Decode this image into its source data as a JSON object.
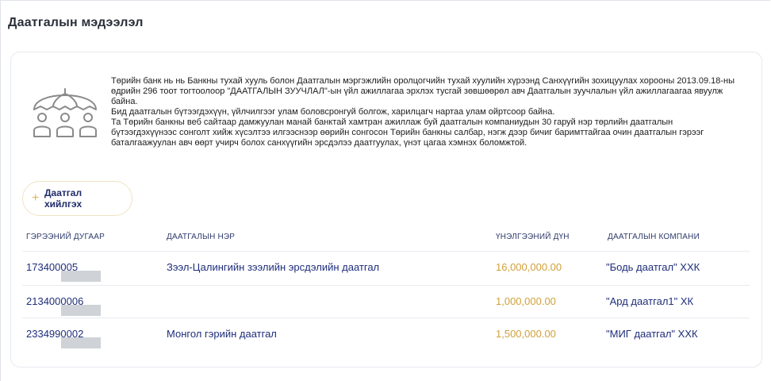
{
  "page": {
    "title": "Даатгалын мэдээлэл"
  },
  "info": {
    "paragraphs": [
      "Төрийн банк нь нь Банкны тухай хууль болон Даатгалын мэргэжлийн оролцогчийн тухай хуулийн хүрээнд Санхүүгийн зохицуулах хорооны 2013.09.18-ны өдрийн 296 тоот тогтоолоор \"ДААТГАЛЫН ЗУУЧЛАЛ\"-ын үйл ажиллагаа эрхлэх тусгай зөвшөөрөл авч Даатгалын зуучлалын үйл ажиллагаагаа явуулж байна.",
      "Бид даатгалын бүтээгдэхүүн, үйлчилгээг улам боловсронгуй болгож, харилцагч нартаа улам ойртсоор байна.",
      "Та Төрийн банкны веб сайтаар дамжуулан манай банктай хамтран ажиллаж буй даатгалын компаниудын 30 гаруй нэр төрлийн даатгалын бүтээгдэхүүнээс сонголт хийж хүсэлтээ илгээснээр өөрийн сонгосон Төрийн банкны салбар, нэгж дээр бичиг баримттайгаа очин даатгалын гэрээг баталгаажуулан авч өөрт учирч болох санхүүгийн эрсдэлээ даатгуулах, үнэт цагаа хэмнэх боломжтой."
    ],
    "illustration_icon": "umbrella-family-icon"
  },
  "actions": {
    "add_label": "Даатгал хийлгэх",
    "add_icon": "plus-icon"
  },
  "table": {
    "headers": [
      "ГЭРЭЭНИЙ ДУГААР",
      "ДААТГАЛЫН НЭР",
      "ҮНЭЛГЭЭНИЙ ДҮН",
      "ДААТГАЛЫН КОМПАНИ"
    ],
    "rows": [
      {
        "contract_prefix": "173400",
        "contract_suffix": "005",
        "name": "Зээл-Цалингийн зээлийн эрсдэлийн даатгал",
        "amount": "16,000,000.00",
        "company": "\"Бодь даатгал\" ХХК"
      },
      {
        "contract_prefix": "213400",
        "contract_suffix": "0006",
        "name": "",
        "amount": "1,000,000.00",
        "company": "\"Ард даатгал1\" ХК"
      },
      {
        "contract_prefix": "233499",
        "contract_suffix": "0002",
        "name": "Монгол гэрийн даатгал",
        "amount": "1,500,000.00",
        "company": "\"МИГ даатгал\" ХХК"
      }
    ]
  },
  "colors": {
    "amount": "#d0a13a",
    "link_text": "#1f2e7a",
    "accent": "#e0b55e"
  }
}
